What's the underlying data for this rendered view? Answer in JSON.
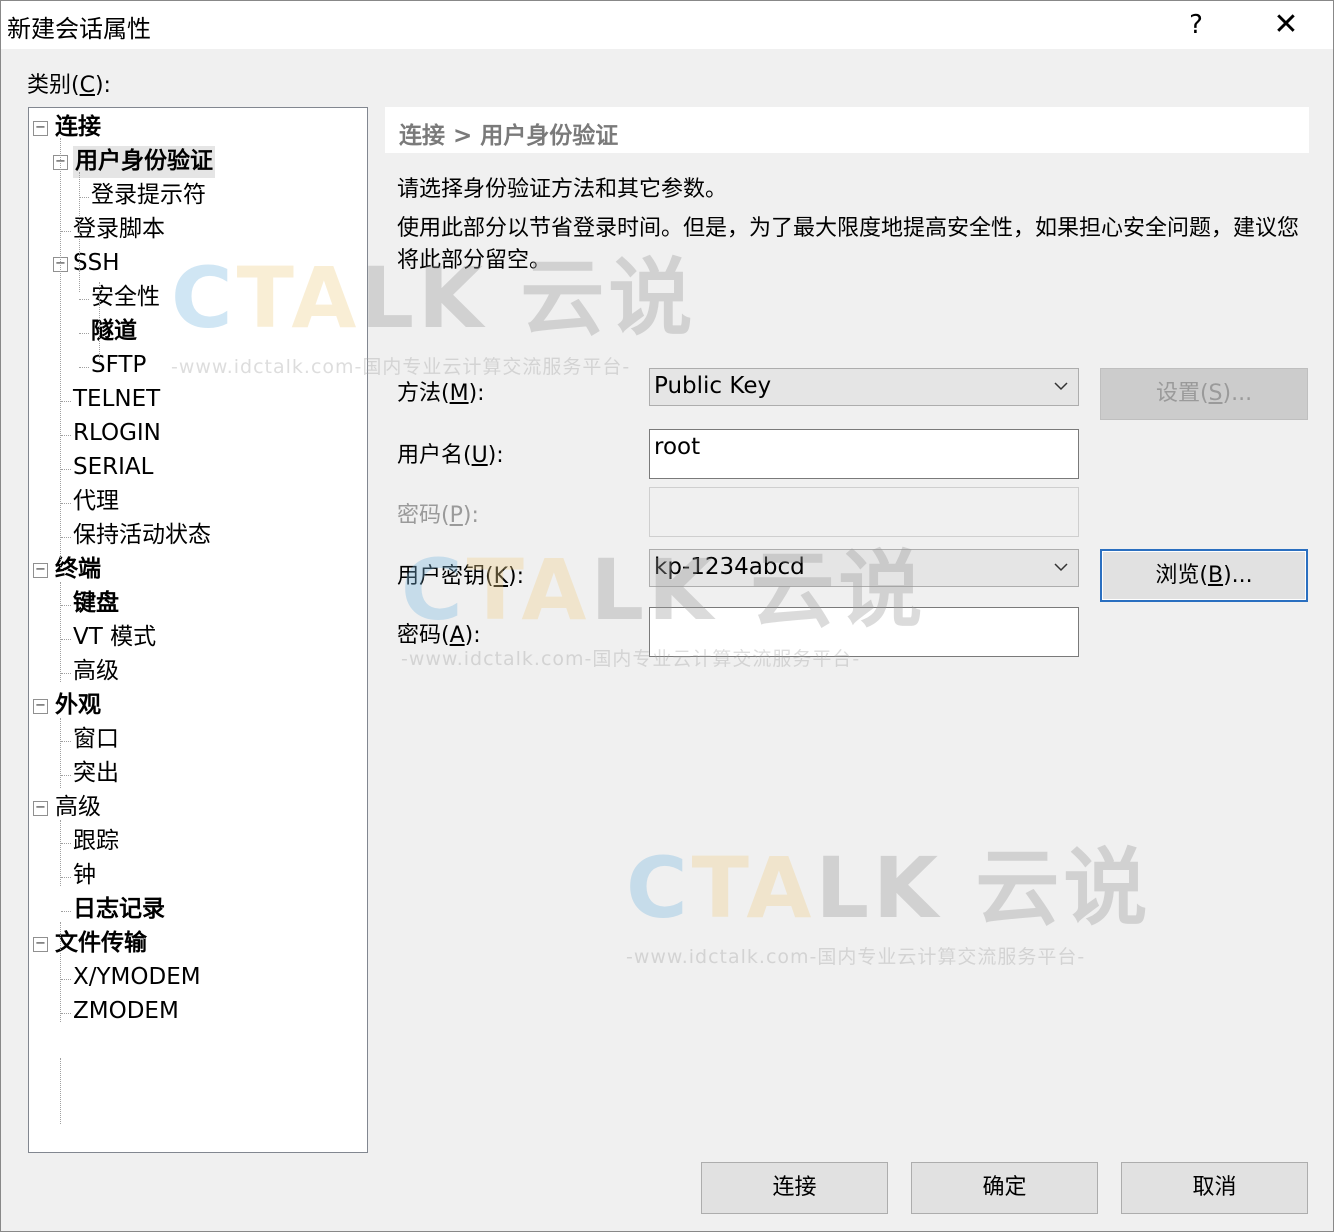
{
  "window": {
    "title": "新建会话属性",
    "help": "?",
    "close": "✕"
  },
  "category_label_prefix": "类别(",
  "category_label_key": "C",
  "category_label_suffix": "):",
  "tree": [
    {
      "label": "连接",
      "bold": true,
      "expander": "−"
    },
    {
      "label": "用户身份验证",
      "bold": true,
      "expander": "−"
    },
    {
      "label": "登录提示符"
    },
    {
      "label": "登录脚本"
    },
    {
      "label": "SSH",
      "expander": "−"
    },
    {
      "label": "安全性"
    },
    {
      "label": "隧道",
      "bold": true
    },
    {
      "label": "SFTP"
    },
    {
      "label": "TELNET"
    },
    {
      "label": "RLOGIN"
    },
    {
      "label": "SERIAL"
    },
    {
      "label": "代理"
    },
    {
      "label": "保持活动状态"
    },
    {
      "label": "终端",
      "bold": true,
      "expander": "−"
    },
    {
      "label": "键盘",
      "bold": true
    },
    {
      "label": "VT 模式"
    },
    {
      "label": "高级"
    },
    {
      "label": "外观",
      "bold": true,
      "expander": "−"
    },
    {
      "label": "窗口"
    },
    {
      "label": "突出"
    },
    {
      "label": "高级",
      "expander": "−"
    },
    {
      "label": "跟踪"
    },
    {
      "label": "钟"
    },
    {
      "label": "日志记录",
      "bold": true
    },
    {
      "label": "文件传输",
      "bold": true,
      "expander": "−"
    },
    {
      "label": "X/YMODEM"
    },
    {
      "label": "ZMODEM"
    }
  ],
  "panel": {
    "breadcrumb": "连接 > 用户身份验证",
    "desc1": "请选择身份验证方法和其它参数。",
    "desc2": "使用此部分以节省登录时间。但是，为了最大限度地提高安全性，如果担心安全问题，建议您将此部分留空。"
  },
  "form": {
    "method": {
      "label": "方法(",
      "key": "M",
      "suffix": "):",
      "value": "Public Key"
    },
    "settings_btn": {
      "label": "设置(",
      "key": "S",
      "suffix": ")..."
    },
    "username": {
      "label": "用户名(",
      "key": "U",
      "suffix": "):",
      "value": "root"
    },
    "password": {
      "label": "密码(",
      "key": "P",
      "suffix": "):",
      "value": ""
    },
    "user_key": {
      "label": "用户密钥(",
      "key": "K",
      "suffix": "):",
      "value": "kp-1234abcd"
    },
    "browse_btn": {
      "label": "浏览(",
      "key": "B",
      "suffix": ")..."
    },
    "passphrase": {
      "label": "密码(",
      "key": "A",
      "suffix": "):",
      "value": ""
    }
  },
  "buttons": {
    "connect": "连接",
    "ok": "确定",
    "cancel": "取消"
  },
  "watermark": {
    "brand_a": "C",
    "brand_b": "TA",
    "brand_c": "LK 云说",
    "tagline": "-www.idctalk.com-国内专业云计算交流服务平台-"
  }
}
